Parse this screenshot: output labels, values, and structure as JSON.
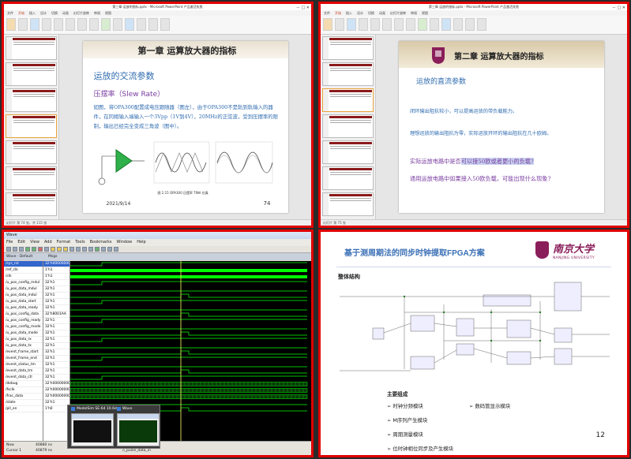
{
  "ppt1": {
    "window_title": "第三章 运放的指标.pptx - Microsoft PowerPoint 产品激活失败",
    "window_controls": "－ □ ✕",
    "tabs": [
      "文件",
      "开始",
      "插入",
      "设计",
      "切换",
      "动画",
      "幻灯片放映",
      "审阅",
      "视图"
    ],
    "status": "幻灯片 第 74 张，共 115 张",
    "slide": {
      "chapter": "第一章 运算放大器的指标",
      "heading": "运放的交流参数",
      "subheading": "压摆率（Slew Rate）",
      "paragraph": "如图，将OPA300配置成电压跟随器（图左），由于OPA300不是轨到轨输入的器件，在同相输入端输入一个3Vpp（1V到4V），20MHz的正弦波，受到压摆率的限制，输出已经完全变成三角波（图中）。",
      "caption": "图 2.15   OPA300 压摆率 TINA 仿真",
      "date": "2021/9/14",
      "page": "74"
    }
  },
  "ppt2": {
    "window_title": "第三章 运放的指标.pptx - Microsoft PowerPoint 产品激活失败",
    "window_controls": "－ □ ✕",
    "tabs": [
      "文件",
      "开始",
      "插入",
      "设计",
      "切换",
      "动画",
      "幻灯片放映",
      "审阅",
      "视图"
    ],
    "status": "幻灯片 第 75 张",
    "slide": {
      "chapter": "第二章 运算放大器的指标",
      "heading": "运放的直流参数",
      "p1": "闭环输出阻抗较小，可以提高运放的带负载能力。",
      "p2": "理想运放的输出阻抗为零，实际运放开环的输出阻抗在几十欧姆。",
      "q1_pre": "实际运放电路中是否",
      "q1_hl": "可以接50欧或者更小的负载?",
      "q2": "通用运放电路中如果接入50欧负载，可能出现什么现象?"
    }
  },
  "modelsim": {
    "window_title": "Wave",
    "menu": [
      "File",
      "Edit",
      "View",
      "Add",
      "Format",
      "Tools",
      "Bookmarks",
      "Window",
      "Help"
    ],
    "pane_title": "Wave - Default",
    "header_msgs": "Msgs",
    "signals": [
      {
        "name": "/sys_rst",
        "value": "32'h00000000"
      },
      {
        "name": "/ref_clk",
        "value": "1'h1"
      },
      {
        "name": "/clk",
        "value": "1'h1"
      },
      {
        "name": "/u_pos_config_mdul",
        "value": "32'h1"
      },
      {
        "name": "/u_pos_data_mdul",
        "value": "32'h1"
      },
      {
        "name": "/u_pos_data_mdul",
        "value": "32'h1"
      },
      {
        "name": "/u_pos_data_start",
        "value": "32'h1"
      },
      {
        "name": "/u_pos_data_ready",
        "value": "32'h1"
      },
      {
        "name": "/u_pos_config_data",
        "value": "32'h8001AA"
      },
      {
        "name": "/u_pos_config_ready",
        "value": "32'h1"
      },
      {
        "name": "/u_pos_config_mode",
        "value": "32'h1"
      },
      {
        "name": "/u_pos_data_mode",
        "value": "32'h1"
      },
      {
        "name": "/u_pos_data_rx",
        "value": "32'h1"
      },
      {
        "name": "/u_pos_data_tx",
        "value": "32'h1"
      },
      {
        "name": "/event_frame_start",
        "value": "32'h1"
      },
      {
        "name": "/event_frame_end",
        "value": "32'h1"
      },
      {
        "name": "/event_status_tm",
        "value": "32'h1"
      },
      {
        "name": "/event_data_tm",
        "value": "32'h1"
      },
      {
        "name": "/event_data_ctl",
        "value": "32'h1"
      },
      {
        "name": "/debug",
        "value": "32'h00000000"
      },
      {
        "name": "/fsclk",
        "value": "32'h00000000"
      },
      {
        "name": "/frac_data",
        "value": "32'h00000000"
      },
      {
        "name": "/state",
        "value": "32'h1"
      },
      {
        "name": "/pll_en",
        "value": "1'h0"
      }
    ],
    "now_label": "Now",
    "now_value": "40880 ns",
    "cursor_label": "Cursor 1",
    "cursor_value": "40879 ns",
    "status_left": "0 ps to 1070 us",
    "status_right": "/i_pulse_data_in",
    "taskbar_items": [
      "ModelSim SE-64 10.6d",
      "Wave"
    ]
  },
  "fpga": {
    "title": "基于测周期法的同步时钟提取FPGA方案",
    "logo_cn": "南京大学",
    "logo_en": "NANJING UNIVERSITY",
    "section": "整体结构",
    "sub": "主要组成",
    "items_left": [
      "时钟分频模块",
      "M序列产生模块",
      "周期测量模块",
      "位时钟相位同步及产生模块"
    ],
    "items_right": [
      "数码管显示模块"
    ],
    "page": "12"
  },
  "colors": {
    "border": "#e00000",
    "ppt_blue": "#2f6bb0",
    "ppt_purple": "#7a3ca0",
    "wave_green": "#00ff00",
    "nju_purple": "#8a1e5a"
  }
}
